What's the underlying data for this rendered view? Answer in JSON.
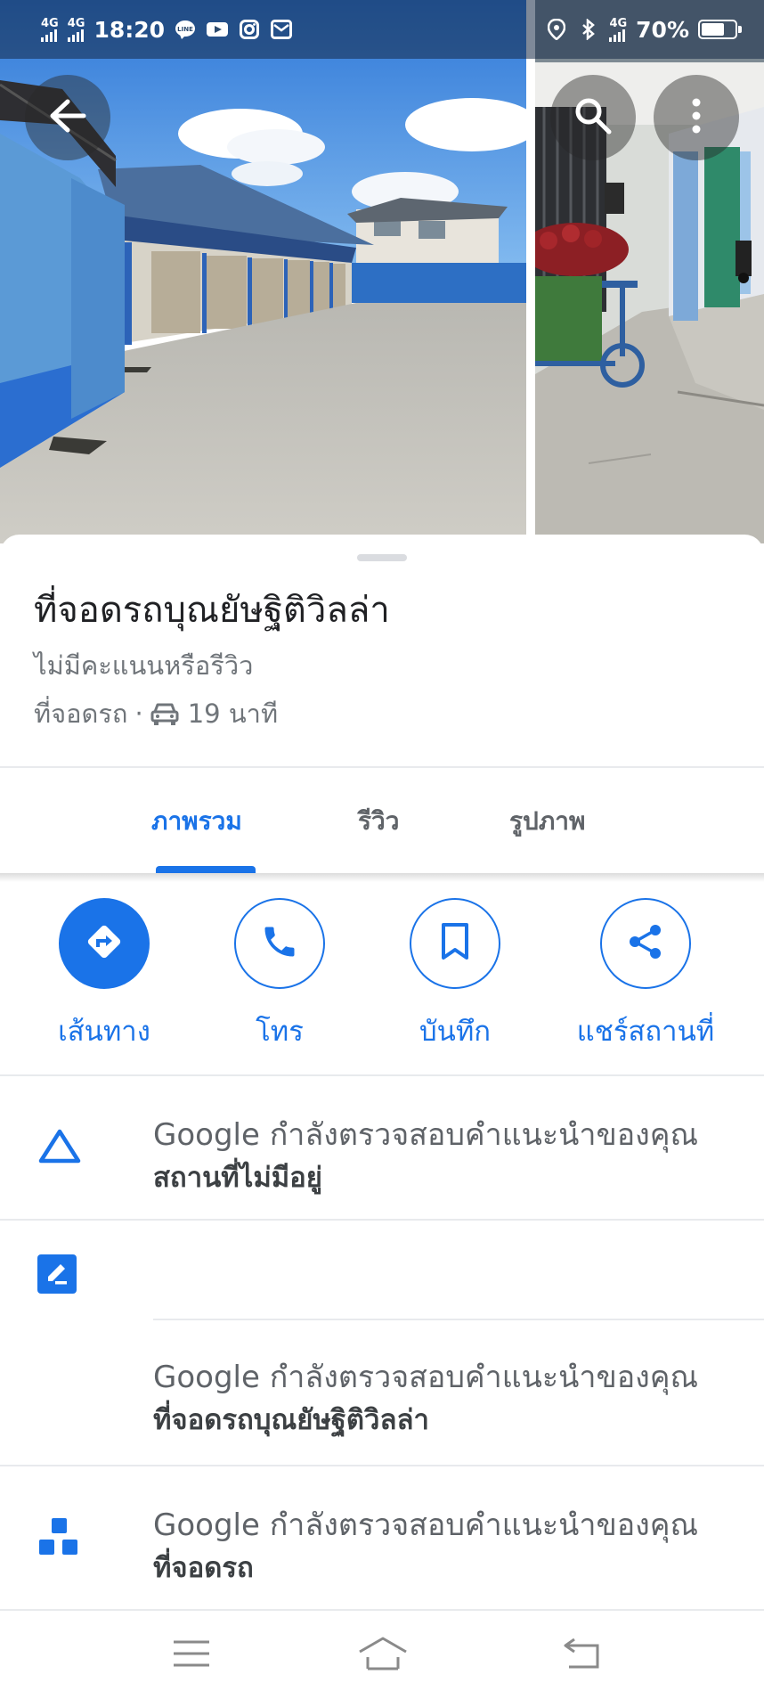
{
  "status_bar": {
    "network_1": "4G",
    "network_2": "4G",
    "time": "18:20",
    "network_3": "4G",
    "battery": "70%",
    "battery_level": 0.7
  },
  "place": {
    "title": "ที่จอดรถบุณยัษฐิติวิลล่า",
    "rating": "ไม่มีคะแนนหรือรีวิว",
    "category": "ที่จอดรถ",
    "separator": "·",
    "drive_time": "19 นาที"
  },
  "tabs": [
    {
      "label": "ภาพรวม",
      "active": true
    },
    {
      "label": "รีวิว",
      "active": false
    },
    {
      "label": "รูปภาพ",
      "active": false
    }
  ],
  "actions": [
    {
      "label": "เส้นทาง",
      "icon": "directions-icon"
    },
    {
      "label": "โทร",
      "icon": "phone-icon"
    },
    {
      "label": "บันทึก",
      "icon": "bookmark-icon"
    },
    {
      "label": "แชร์สถานที่",
      "icon": "share-icon"
    }
  ],
  "edits": [
    {
      "text": "Google กำลังตรวจสอบคำแนะนำของคุณ",
      "value": "สถานที่ไม่มีอยู่",
      "icon": "warning-triangle-icon"
    },
    {
      "text": "Google กำลังตรวจสอบคำแนะนำของคุณ",
      "value": "ที่จอดรถบุณยัษฐิติวิลล่า",
      "icon": "edit-icon"
    },
    {
      "text": "Google กำลังตรวจสอบคำแนะนำของคุณ",
      "value": "ที่จอดรถ",
      "icon": "category-icon"
    }
  ],
  "colors": {
    "accent": "#1a73e8",
    "text_primary": "#202124",
    "text_secondary": "#70757a"
  }
}
